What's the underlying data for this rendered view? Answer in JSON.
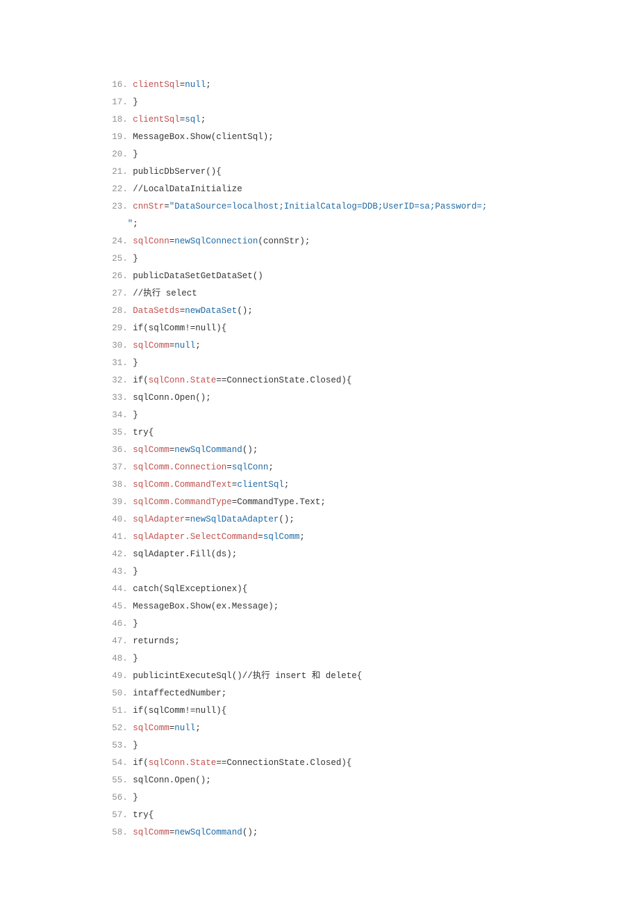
{
  "lines": [
    {
      "n": "16",
      "seg": [
        {
          "c": "red",
          "t": "clientSql"
        },
        {
          "t": "="
        },
        {
          "c": "blue",
          "t": "null"
        },
        {
          "t": ";"
        }
      ]
    },
    {
      "n": "17",
      "seg": [
        {
          "t": "}"
        }
      ]
    },
    {
      "n": "18",
      "seg": [
        {
          "c": "red",
          "t": "clientSql"
        },
        {
          "t": "="
        },
        {
          "c": "blue",
          "t": "sql"
        },
        {
          "t": ";"
        }
      ]
    },
    {
      "n": "19",
      "seg": [
        {
          "t": "MessageBox.Show(clientSql);"
        }
      ]
    },
    {
      "n": "20",
      "seg": [
        {
          "t": "}"
        }
      ]
    },
    {
      "n": "21",
      "seg": [
        {
          "t": "publicDbServer(){"
        }
      ]
    },
    {
      "n": "22",
      "seg": [
        {
          "t": "//LocalDataInitialize"
        }
      ]
    },
    {
      "n": "23",
      "seg": [
        {
          "c": "red",
          "t": "cnnStr"
        },
        {
          "t": "="
        },
        {
          "c": "blue",
          "t": "\"DataSource=localhost;InitialCatalog=DDB;UserID=sa;Password=;"
        }
      ],
      "cont": [
        {
          "c": "blue",
          "t": "\""
        },
        {
          "t": ";"
        }
      ]
    },
    {
      "n": "24",
      "seg": [
        {
          "c": "red",
          "t": "sqlConn"
        },
        {
          "t": "="
        },
        {
          "c": "blue",
          "t": "newSqlConnection"
        },
        {
          "t": "(connStr);"
        }
      ]
    },
    {
      "n": "25",
      "seg": [
        {
          "t": "}"
        }
      ]
    },
    {
      "n": "26",
      "seg": [
        {
          "t": "publicDataSetGetDataSet()"
        }
      ]
    },
    {
      "n": "27",
      "seg": [
        {
          "t": "//执行 select"
        }
      ]
    },
    {
      "n": "28",
      "seg": [
        {
          "c": "red",
          "t": "DataSetds"
        },
        {
          "t": "="
        },
        {
          "c": "blue",
          "t": "newDataSet"
        },
        {
          "t": "();"
        }
      ]
    },
    {
      "n": "29",
      "seg": [
        {
          "t": "if(sqlComm!=null){"
        }
      ]
    },
    {
      "n": "30",
      "seg": [
        {
          "c": "red",
          "t": "sqlComm"
        },
        {
          "t": "="
        },
        {
          "c": "blue",
          "t": "null"
        },
        {
          "t": ";"
        }
      ]
    },
    {
      "n": "31",
      "seg": [
        {
          "t": "}"
        }
      ]
    },
    {
      "n": "32",
      "seg": [
        {
          "t": "if("
        },
        {
          "c": "red",
          "t": "sqlConn.State"
        },
        {
          "t": "==ConnectionState.Closed){"
        }
      ]
    },
    {
      "n": "33",
      "seg": [
        {
          "t": "sqlConn.Open();"
        }
      ]
    },
    {
      "n": "34",
      "seg": [
        {
          "t": "}"
        }
      ]
    },
    {
      "n": "35",
      "seg": [
        {
          "t": "try{"
        }
      ]
    },
    {
      "n": "36",
      "seg": [
        {
          "c": "red",
          "t": "sqlComm"
        },
        {
          "t": "="
        },
        {
          "c": "blue",
          "t": "newSqlCommand"
        },
        {
          "t": "();"
        }
      ]
    },
    {
      "n": "37",
      "seg": [
        {
          "c": "red",
          "t": "sqlComm.Connection"
        },
        {
          "t": "="
        },
        {
          "c": "blue",
          "t": "sqlConn"
        },
        {
          "t": ";"
        }
      ]
    },
    {
      "n": "38",
      "seg": [
        {
          "c": "red",
          "t": "sqlComm.CommandText"
        },
        {
          "t": "="
        },
        {
          "c": "blue",
          "t": "clientSql"
        },
        {
          "t": ";"
        }
      ]
    },
    {
      "n": "39",
      "seg": [
        {
          "c": "red",
          "t": "sqlComm.CommandType"
        },
        {
          "t": "=CommandType.Text;"
        }
      ]
    },
    {
      "n": "40",
      "seg": [
        {
          "c": "red",
          "t": "sqlAdapter"
        },
        {
          "t": "="
        },
        {
          "c": "blue",
          "t": "newSqlDataAdapter"
        },
        {
          "t": "();"
        }
      ]
    },
    {
      "n": "41",
      "seg": [
        {
          "c": "red",
          "t": "sqlAdapter.SelectCommand"
        },
        {
          "t": "="
        },
        {
          "c": "blue",
          "t": "sqlComm"
        },
        {
          "t": ";"
        }
      ]
    },
    {
      "n": "42",
      "seg": [
        {
          "t": "sqlAdapter.Fill(ds);"
        }
      ]
    },
    {
      "n": "43",
      "seg": [
        {
          "t": "}"
        }
      ]
    },
    {
      "n": "44",
      "seg": [
        {
          "t": "catch(SqlExceptionex){"
        }
      ]
    },
    {
      "n": "45",
      "seg": [
        {
          "t": "MessageBox.Show(ex.Message);"
        }
      ]
    },
    {
      "n": "46",
      "seg": [
        {
          "t": "}"
        }
      ]
    },
    {
      "n": "47",
      "seg": [
        {
          "t": "returnds;"
        }
      ]
    },
    {
      "n": "48",
      "seg": [
        {
          "t": "}"
        }
      ]
    },
    {
      "n": "49",
      "seg": [
        {
          "t": "publicintExecuteSql()//执行 insert 和 delete{"
        }
      ]
    },
    {
      "n": "50",
      "seg": [
        {
          "t": "intaffectedNumber;"
        }
      ]
    },
    {
      "n": "51",
      "seg": [
        {
          "t": "if(sqlComm!=null){"
        }
      ]
    },
    {
      "n": "52",
      "seg": [
        {
          "c": "red",
          "t": "sqlComm"
        },
        {
          "t": "="
        },
        {
          "c": "blue",
          "t": "null"
        },
        {
          "t": ";"
        }
      ]
    },
    {
      "n": "53",
      "seg": [
        {
          "t": "}"
        }
      ]
    },
    {
      "n": "54",
      "seg": [
        {
          "t": "if("
        },
        {
          "c": "red",
          "t": "sqlConn.State"
        },
        {
          "t": "==ConnectionState.Closed){"
        }
      ]
    },
    {
      "n": "55",
      "seg": [
        {
          "t": "sqlConn.Open();"
        }
      ]
    },
    {
      "n": "56",
      "seg": [
        {
          "t": "}"
        }
      ]
    },
    {
      "n": "57",
      "seg": [
        {
          "t": "try{"
        }
      ]
    },
    {
      "n": "58",
      "seg": [
        {
          "c": "red",
          "t": "sqlComm"
        },
        {
          "t": "="
        },
        {
          "c": "blue",
          "t": "newSqlCommand"
        },
        {
          "t": "();"
        }
      ]
    }
  ]
}
